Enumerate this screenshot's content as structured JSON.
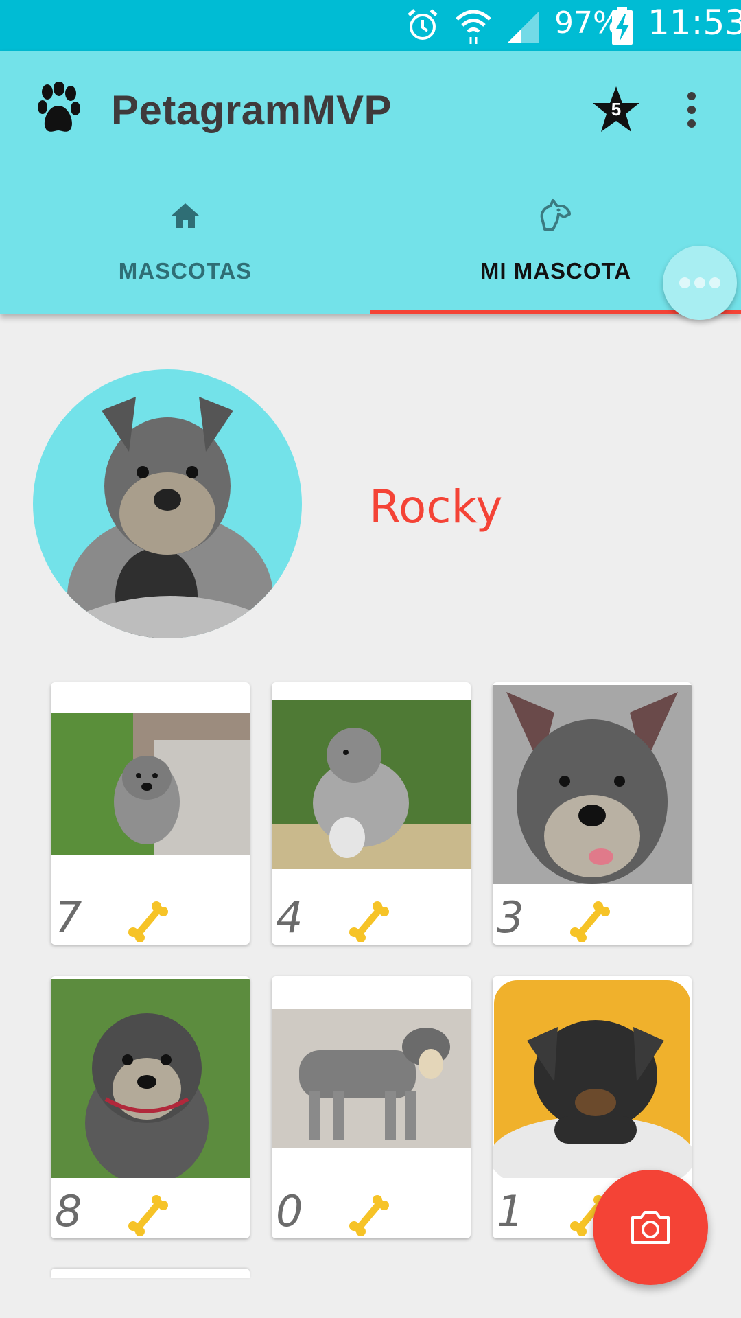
{
  "status_bar": {
    "battery_percent": "97%",
    "time": "11:53",
    "icons": [
      "alarm-icon",
      "wifi-icon",
      "signal-icon",
      "battery-charging-icon"
    ]
  },
  "app_bar": {
    "title": "PetagramMVP",
    "logo_icon": "paw-icon",
    "favorites_badge": "5",
    "actions": [
      "star-icon",
      "more-vert-icon"
    ]
  },
  "tabs": [
    {
      "label": "MASCOTAS",
      "icon": "home-icon",
      "selected": false
    },
    {
      "label": "MI MASCOTA",
      "icon": "dog-icon",
      "selected": true
    }
  ],
  "profile": {
    "name": "Rocky"
  },
  "photos": [
    {
      "likes": "7"
    },
    {
      "likes": "4"
    },
    {
      "likes": "3"
    },
    {
      "likes": "8"
    },
    {
      "likes": "0"
    },
    {
      "likes": "1"
    }
  ],
  "colors": {
    "status_bar": "#00bcd4",
    "app_bar": "#73e2e9",
    "accent": "#f44336",
    "bone": "#f6c327"
  }
}
